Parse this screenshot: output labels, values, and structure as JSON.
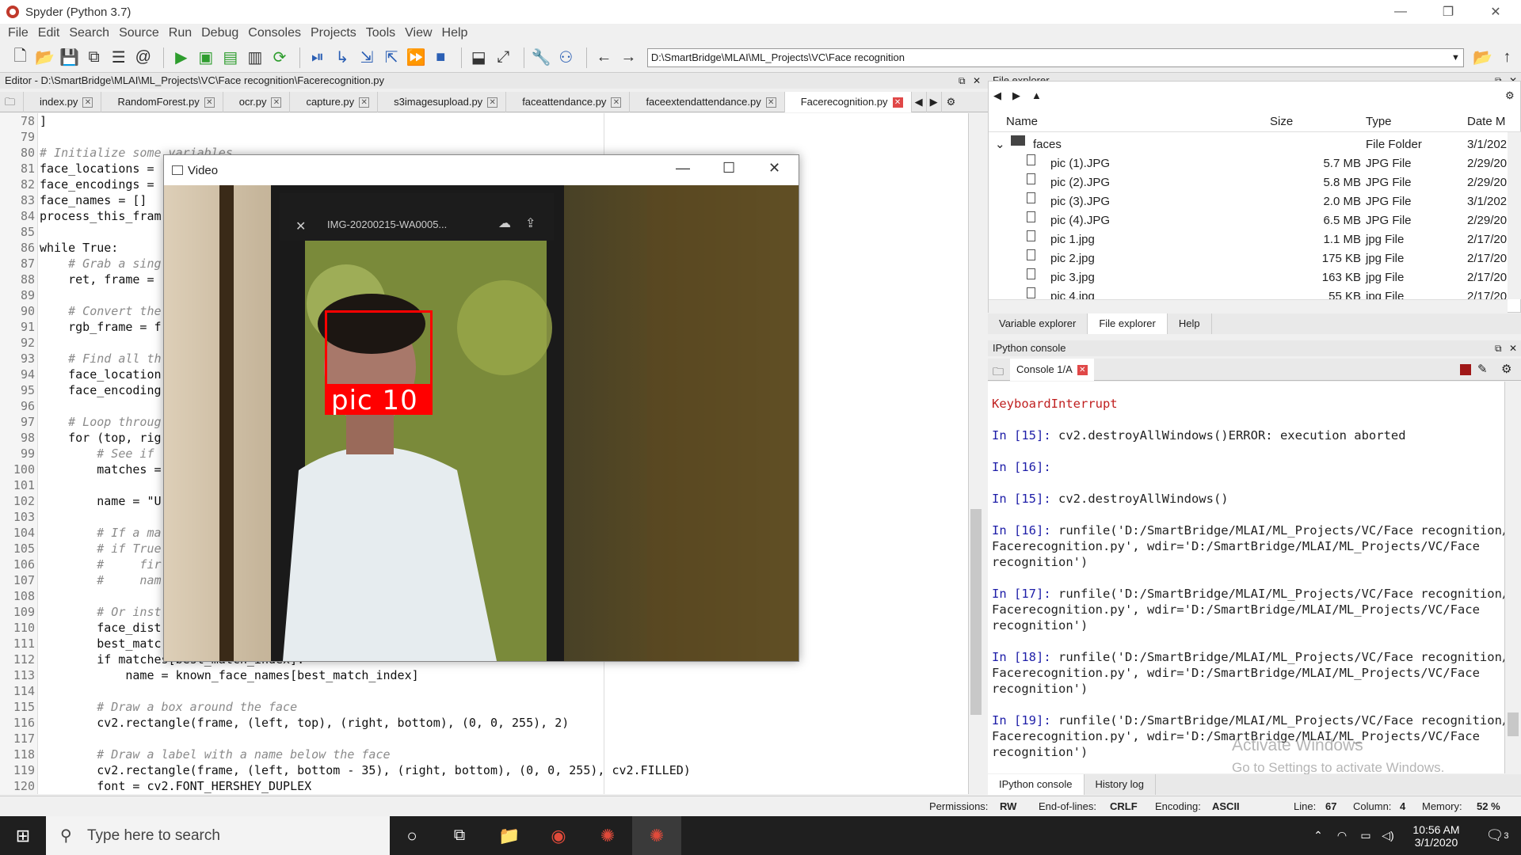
{
  "window": {
    "title": "Spyder (Python 3.7)"
  },
  "menu": [
    "File",
    "Edit",
    "Search",
    "Source",
    "Run",
    "Debug",
    "Consoles",
    "Projects",
    "Tools",
    "View",
    "Help"
  ],
  "toolbar": {
    "path": "D:\\SmartBridge\\MLAI\\ML_Projects\\VC\\Face recognition"
  },
  "editor": {
    "header": "Editor - D:\\SmartBridge\\MLAI\\ML_Projects\\VC\\Face recognition\\Facerecognition.py",
    "tabs": [
      "index.py",
      "RandomForest.py",
      "ocr.py",
      "capture.py",
      "s3imagesupload.py",
      "faceattendance.py",
      "faceextendattendance.py",
      "Facerecognition.py"
    ],
    "lines": [
      {
        "n": "78",
        "t": "]"
      },
      {
        "n": "79",
        "t": ""
      },
      {
        "n": "80",
        "t": "# Initialize some variables"
      },
      {
        "n": "81",
        "t": "face_locations = "
      },
      {
        "n": "82",
        "t": "face_encodings = "
      },
      {
        "n": "83",
        "t": "face_names = []"
      },
      {
        "n": "84",
        "t": "process_this_fram"
      },
      {
        "n": "85",
        "t": ""
      },
      {
        "n": "86",
        "t": "while True:"
      },
      {
        "n": "87",
        "t": "    # Grab a sing"
      },
      {
        "n": "88",
        "t": "    ret, frame = "
      },
      {
        "n": "89",
        "t": ""
      },
      {
        "n": "90",
        "t": "    # Convert the"
      },
      {
        "n": "91",
        "t": "    rgb_frame = f"
      },
      {
        "n": "92",
        "t": ""
      },
      {
        "n": "93",
        "t": "    # Find all th"
      },
      {
        "n": "94",
        "t": "    face_location"
      },
      {
        "n": "95",
        "t": "    face_encoding"
      },
      {
        "n": "96",
        "t": ""
      },
      {
        "n": "97",
        "t": "    # Loop throug"
      },
      {
        "n": "98",
        "t": "    for (top, rig"
      },
      {
        "n": "99",
        "t": "        # See if "
      },
      {
        "n": "100",
        "t": "        matches ="
      },
      {
        "n": "101",
        "t": ""
      },
      {
        "n": "102",
        "t": "        name = \"U"
      },
      {
        "n": "103",
        "t": ""
      },
      {
        "n": "104",
        "t": "        # If a ma"
      },
      {
        "n": "105",
        "t": "        # if True"
      },
      {
        "n": "106",
        "t": "        #     fir"
      },
      {
        "n": "107",
        "t": "        #     nam"
      },
      {
        "n": "108",
        "t": ""
      },
      {
        "n": "109",
        "t": "        # Or inst"
      },
      {
        "n": "110",
        "t": "        face_dist"
      },
      {
        "n": "111",
        "t": "        best_matc"
      },
      {
        "n": "112",
        "t": "        if matches[best_match_index]:"
      },
      {
        "n": "113",
        "t": "            name = known_face_names[best_match_index]"
      },
      {
        "n": "114",
        "t": ""
      },
      {
        "n": "115",
        "t": "        # Draw a box around the face"
      },
      {
        "n": "116",
        "t": "        cv2.rectangle(frame, (left, top), (right, bottom), (0, 0, 255), 2)"
      },
      {
        "n": "117",
        "t": ""
      },
      {
        "n": "118",
        "t": "        # Draw a label with a name below the face"
      },
      {
        "n": "119",
        "t": "        cv2.rectangle(frame, (left, bottom - 35), (right, bottom), (0, 0, 255), cv2.FILLED)"
      },
      {
        "n": "120",
        "t": "        font = cv2.FONT_HERSHEY_DUPLEX"
      }
    ]
  },
  "video": {
    "title": "Video",
    "label": "pic 10",
    "phone_text": "IMG-20200215-WA0005..."
  },
  "file_explorer": {
    "header": "File explorer",
    "columns": [
      "Name",
      "Size",
      "Type",
      "Date M"
    ],
    "folder": {
      "name": "faces",
      "type": "File Folder",
      "date": "3/1/202"
    },
    "files": [
      {
        "name": "pic (1).JPG",
        "size": "5.7 MB",
        "type": "JPG File",
        "date": "2/29/20"
      },
      {
        "name": "pic (2).JPG",
        "size": "5.8 MB",
        "type": "JPG File",
        "date": "2/29/20"
      },
      {
        "name": "pic (3).JPG",
        "size": "2.0 MB",
        "type": "JPG File",
        "date": "3/1/202"
      },
      {
        "name": "pic (4).JPG",
        "size": "6.5 MB",
        "type": "JPG File",
        "date": "2/29/20"
      },
      {
        "name": "pic 1.jpg",
        "size": "1.1 MB",
        "type": "jpg File",
        "date": "2/17/20"
      },
      {
        "name": "pic 2.jpg",
        "size": "175 KB",
        "type": "jpg File",
        "date": "2/17/20"
      },
      {
        "name": "pic 3.jpg",
        "size": "163 KB",
        "type": "jpg File",
        "date": "2/17/20"
      },
      {
        "name": "pic 4.jpg",
        "size": "55 KB",
        "type": "jpg File",
        "date": "2/17/20"
      }
    ],
    "tabs": [
      "Variable explorer",
      "File explorer",
      "Help"
    ]
  },
  "console": {
    "header": "IPython console",
    "tab": "Console 1/A",
    "lines": [
      {
        "cls": "err",
        "t": "KeyboardInterrupt"
      },
      {
        "cls": "in",
        "t": "In [15]:",
        "rest": " cv2.destroyAllWindows()ERROR: execution aborted"
      },
      {
        "cls": "in",
        "t": "In [16]:",
        "rest": ""
      },
      {
        "cls": "in",
        "t": "In [15]:",
        "rest": " cv2.destroyAllWindows()"
      },
      {
        "cls": "in",
        "t": "In [16]:",
        "rest": " runfile('D:/SmartBridge/MLAI/ML_Projects/VC/Face recognition/"
      },
      {
        "cls": "cont",
        "t": "Facerecognition.py', wdir='D:/SmartBridge/MLAI/ML_Projects/VC/Face"
      },
      {
        "cls": "cont",
        "t": "recognition')"
      },
      {
        "cls": "in",
        "t": "In [17]:",
        "rest": " runfile('D:/SmartBridge/MLAI/ML_Projects/VC/Face recognition/"
      },
      {
        "cls": "cont",
        "t": "Facerecognition.py', wdir='D:/SmartBridge/MLAI/ML_Projects/VC/Face"
      },
      {
        "cls": "cont",
        "t": "recognition')"
      },
      {
        "cls": "in",
        "t": "In [18]:",
        "rest": " runfile('D:/SmartBridge/MLAI/ML_Projects/VC/Face recognition/"
      },
      {
        "cls": "cont",
        "t": "Facerecognition.py', wdir='D:/SmartBridge/MLAI/ML_Projects/VC/Face"
      },
      {
        "cls": "cont",
        "t": "recognition')"
      },
      {
        "cls": "in",
        "t": "In [19]:",
        "rest": " runfile('D:/SmartBridge/MLAI/ML_Projects/VC/Face recognition/"
      },
      {
        "cls": "cont",
        "t": "Facerecognition.py', wdir='D:/SmartBridge/MLAI/ML_Projects/VC/Face"
      },
      {
        "cls": "cont",
        "t": "recognition')"
      }
    ],
    "tabs": [
      "IPython console",
      "History log"
    ]
  },
  "status": {
    "permissions_label": "Permissions:",
    "permissions": "RW",
    "eol_label": "End-of-lines:",
    "eol": "CRLF",
    "encoding_label": "Encoding:",
    "encoding": "ASCII",
    "line_label": "Line:",
    "line": "67",
    "column_label": "Column:",
    "column": "4",
    "memory_label": "Memory:",
    "memory": "52 %"
  },
  "watermark": {
    "title": "Activate Windows",
    "sub": "Go to Settings to activate Windows."
  },
  "taskbar": {
    "search_placeholder": "Type here to search",
    "time": "10:56 AM",
    "date": "3/1/2020",
    "notifications": "3"
  }
}
